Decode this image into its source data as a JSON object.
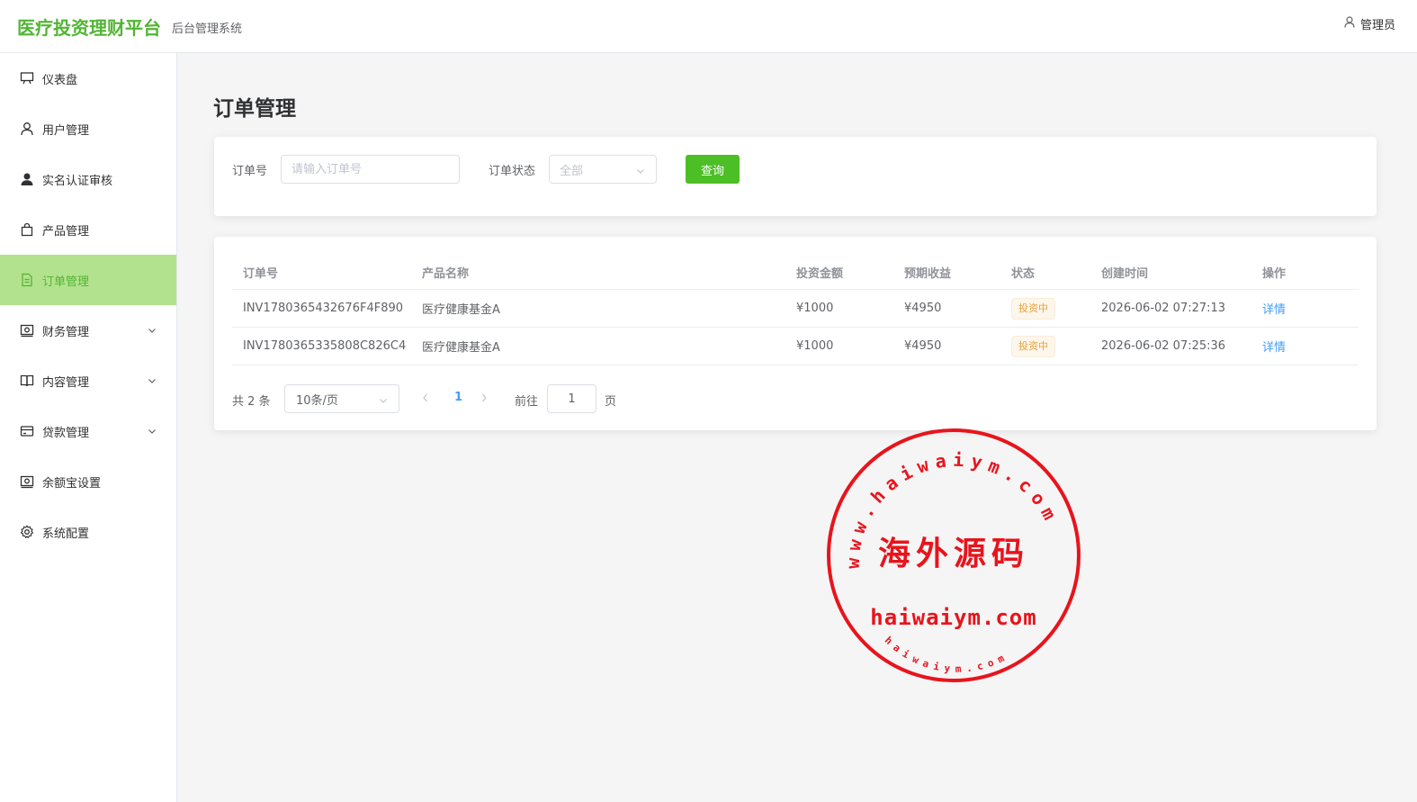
{
  "header": {
    "brand": "医疗投资理财平台",
    "subtitle": "后台管理系统",
    "user": "管理员"
  },
  "sidebar": {
    "items": [
      {
        "label": "仪表盘",
        "icon": "presentation-board-icon",
        "active": false,
        "expandable": false
      },
      {
        "label": "用户管理",
        "icon": "user-icon",
        "active": false,
        "expandable": false
      },
      {
        "label": "实名认证审核",
        "icon": "user-filled-icon",
        "active": false,
        "expandable": false
      },
      {
        "label": "产品管理",
        "icon": "shopping-bag-icon",
        "active": false,
        "expandable": false
      },
      {
        "label": "订单管理",
        "icon": "document-icon",
        "active": true,
        "expandable": false
      },
      {
        "label": "财务管理",
        "icon": "wallet-icon",
        "active": false,
        "expandable": true
      },
      {
        "label": "内容管理",
        "icon": "book-icon",
        "active": false,
        "expandable": true
      },
      {
        "label": "贷款管理",
        "icon": "credit-card-icon",
        "active": false,
        "expandable": true
      },
      {
        "label": "余额宝设置",
        "icon": "wallet-icon",
        "active": false,
        "expandable": false
      },
      {
        "label": "系统配置",
        "icon": "gear-icon",
        "active": false,
        "expandable": false
      }
    ]
  },
  "main": {
    "title": "订单管理",
    "search": {
      "order_label": "订单号",
      "order_placeholder": "请输入订单号",
      "status_label": "订单状态",
      "status_value": "全部",
      "query_button": "查询"
    },
    "table": {
      "columns": [
        "订单号",
        "产品名称",
        "投资金额",
        "预期收益",
        "状态",
        "创建时间",
        "操作"
      ],
      "rows": [
        {
          "order_no": "INV1780365432676F4F890",
          "product": "医疗健康基金A",
          "amount": "¥1000",
          "profit": "¥4950",
          "status": "投资中",
          "created": "2026-06-02 07:27:13",
          "action": "详情"
        },
        {
          "order_no": "INV1780365335808C826C4",
          "product": "医疗健康基金A",
          "amount": "¥1000",
          "profit": "¥4950",
          "status": "投资中",
          "created": "2026-06-02 07:25:36",
          "action": "详情"
        }
      ]
    },
    "pagination": {
      "total": "共 2 条",
      "page_size": "10条/页",
      "current_page": "1",
      "goto_label": "前往",
      "goto_value": "1",
      "page_suffix": "页"
    }
  },
  "watermark": {
    "top_text": "www.haiwaiym.com",
    "center_text": "海外源码",
    "domain_text": "haiwaiym.com",
    "bottom_text": "haiwaiym.com",
    "color": "#e8141c"
  },
  "colors": {
    "brand": "#52b534",
    "active_bg": "#b3e28e",
    "primary_button": "#4cbf26",
    "link": "#409eff",
    "status_tag": "#e6a23c"
  }
}
